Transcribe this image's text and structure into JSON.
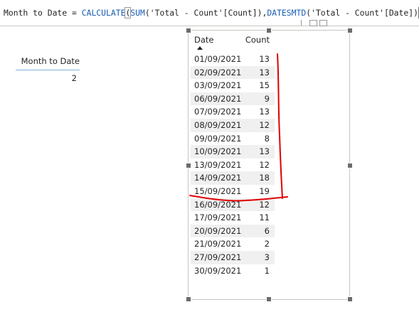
{
  "formula_bar": {
    "measure_prefix": "Month to Date = ",
    "fn_calculate": "CALCULATE",
    "paren_open": "(",
    "fn_sum": "SUM",
    "arg_sum": "('Total - Count'[Count]),",
    "fn_datesmtd": "DATESMTD",
    "arg_dates": "('Total - Count'[Date])",
    "paren_close": ")"
  },
  "card": {
    "header": "Month to Date",
    "value": "2"
  },
  "table": {
    "columns": [
      "Date",
      "Count"
    ],
    "rows": [
      {
        "date": "01/09/2021",
        "count": "13"
      },
      {
        "date": "02/09/2021",
        "count": "13"
      },
      {
        "date": "03/09/2021",
        "count": "15"
      },
      {
        "date": "06/09/2021",
        "count": "9"
      },
      {
        "date": "07/09/2021",
        "count": "13"
      },
      {
        "date": "08/09/2021",
        "count": "12"
      },
      {
        "date": "09/09/2021",
        "count": "8"
      },
      {
        "date": "10/09/2021",
        "count": "13"
      },
      {
        "date": "13/09/2021",
        "count": "12"
      },
      {
        "date": "14/09/2021",
        "count": "18"
      },
      {
        "date": "15/09/2021",
        "count": "19"
      },
      {
        "date": "16/09/2021",
        "count": "12"
      },
      {
        "date": "17/09/2021",
        "count": "11"
      },
      {
        "date": "20/09/2021",
        "count": "6"
      },
      {
        "date": "21/09/2021",
        "count": "2"
      },
      {
        "date": "27/09/2021",
        "count": "3"
      },
      {
        "date": "30/09/2021",
        "count": "1"
      }
    ]
  },
  "colors": {
    "annotation": "#e00000",
    "accent_line": "#7fb2d9",
    "function": "#1a5fb4"
  }
}
